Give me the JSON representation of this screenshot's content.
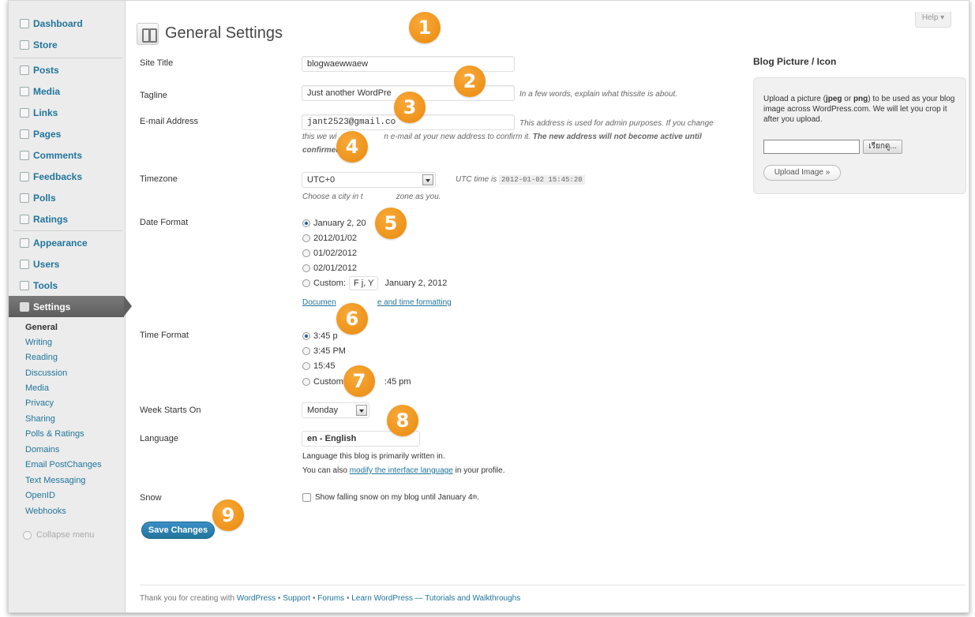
{
  "sidebar": {
    "items": [
      {
        "label": "Dashboard",
        "icon": "dashboard-icon"
      },
      {
        "label": "Store",
        "icon": "store-icon"
      },
      {
        "label": "Posts",
        "icon": "posts-icon"
      },
      {
        "label": "Media",
        "icon": "media-icon"
      },
      {
        "label": "Links",
        "icon": "links-icon"
      },
      {
        "label": "Pages",
        "icon": "pages-icon"
      },
      {
        "label": "Comments",
        "icon": "comments-icon"
      },
      {
        "label": "Feedbacks",
        "icon": "feedbacks-icon"
      },
      {
        "label": "Polls",
        "icon": "polls-icon"
      },
      {
        "label": "Ratings",
        "icon": "ratings-icon"
      },
      {
        "label": "Appearance",
        "icon": "appearance-icon"
      },
      {
        "label": "Users",
        "icon": "users-icon"
      },
      {
        "label": "Tools",
        "icon": "tools-icon"
      }
    ],
    "active": {
      "label": "Settings",
      "icon": "settings-icon"
    },
    "submenu": [
      "General",
      "Writing",
      "Reading",
      "Discussion",
      "Media",
      "Privacy",
      "Sharing",
      "Polls & Ratings",
      "Domains",
      "Email PostChanges",
      "Text Messaging",
      "OpenID",
      "Webhooks"
    ],
    "collapse_label": "Collapse menu"
  },
  "header": {
    "title": "General Settings",
    "help_label": "Help ▾"
  },
  "form": {
    "site_title": {
      "label": "Site Title",
      "value": "blogwaewwaew"
    },
    "tagline": {
      "label": "Tagline",
      "value": "Just another WordPre",
      "desc": "In a few words, explain what thissite is about."
    },
    "email": {
      "label": "E-mail Address",
      "value": "jant2523@gmail.co",
      "desc1": "This address is used for admin purposes. If you change",
      "desc2_a": "this we wi",
      "desc2_b": "n e-mail at your new address to confirm it.",
      "desc2_bold": "The new address will not become active until",
      "desc3": "confirmed"
    },
    "timezone": {
      "label": "Timezone",
      "value": "UTC+0",
      "utc_label": "UTC time is",
      "utc_time": "2012-01-02 15:45:20",
      "desc_a": "Choose a city in t",
      "desc_b": "zone as you."
    },
    "date_format": {
      "label": "Date Format",
      "options": [
        "January 2, 20",
        "2012/01/02",
        "01/02/2012",
        "02/01/2012"
      ],
      "custom_label": "Custom:",
      "custom_value": "F j, Y",
      "custom_preview": "January 2, 2012",
      "doc_link_a": "Documen",
      "doc_link_b": "e and time formatting"
    },
    "time_format": {
      "label": "Time Format",
      "options": [
        "3:45 p",
        "3:45 PM",
        "15:45"
      ],
      "custom_label": "Custom",
      "custom_preview": ":45 pm"
    },
    "week_starts": {
      "label": "Week Starts On",
      "value": "Monday"
    },
    "language": {
      "label": "Language",
      "value": "en - English",
      "desc1": "Language this blog is primarily written in.",
      "desc2_a": "You can also",
      "desc2_link": "modify the interface language",
      "desc2_b": "in your profile."
    },
    "snow": {
      "label": "Snow",
      "text": "Show falling snow on my blog until January 4",
      "sup": "th",
      "tail": "."
    },
    "save_label": "Save Changes"
  },
  "blog_picture": {
    "title": "Blog Picture / Icon",
    "text_a": "Upload a picture (",
    "jpeg": "jpeg",
    "or": " or ",
    "png": "png",
    "text_b": ") to be used as your blog image across WordPress.com. We will let you crop it after you upload.",
    "browse_label": "เรียกดู...",
    "upload_label": "Upload Image »"
  },
  "footer": {
    "prefix": "Thank you for creating with",
    "wordpress": "WordPress",
    "sep": " • ",
    "support": "Support",
    "forums": "Forums",
    "learn": "Learn WordPress — Tutorials and Walkthroughs"
  },
  "callouts": [
    "1",
    "2",
    "3",
    "4",
    "5",
    "6",
    "7",
    "8",
    "9"
  ],
  "colors": {
    "accent": "#21759b",
    "callout": "#f39c1c",
    "active_menu": "#6b6b6b"
  }
}
